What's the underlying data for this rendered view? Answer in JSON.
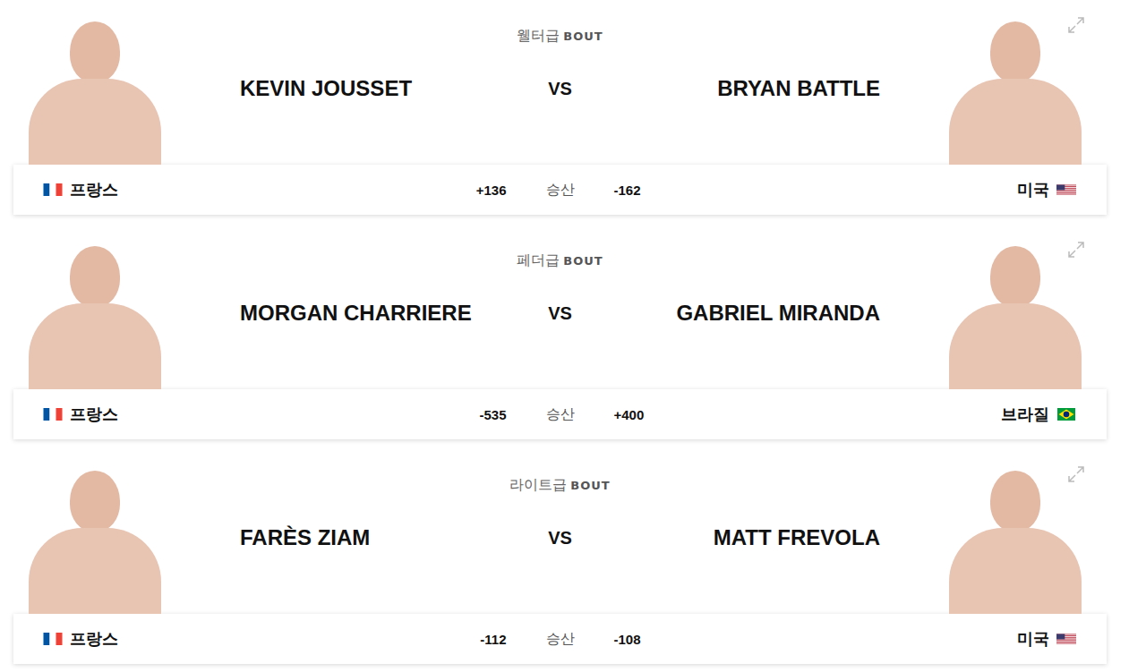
{
  "bouts": [
    {
      "weight_class": "웰터급",
      "bout_label": "BOUT",
      "vs": "VS",
      "odds_label": "승산",
      "left": {
        "name": "KEVIN JOUSSET",
        "country": "프랑스",
        "kind": "fr",
        "odds": "+136"
      },
      "right": {
        "name": "BRYAN BATTLE",
        "country": "미국",
        "kind": "us",
        "odds": "-162"
      }
    },
    {
      "weight_class": "페더급",
      "bout_label": "BOUT",
      "vs": "VS",
      "odds_label": "승산",
      "left": {
        "name": "MORGAN CHARRIERE",
        "country": "프랑스",
        "kind": "fr",
        "odds": "-535"
      },
      "right": {
        "name": "GABRIEL MIRANDA",
        "country": "브라질",
        "kind": "br",
        "odds": "+400"
      }
    },
    {
      "weight_class": "라이트급",
      "bout_label": "BOUT",
      "vs": "VS",
      "odds_label": "승산",
      "left": {
        "name": "FARÈS ZIAM",
        "country": "프랑스",
        "kind": "fr",
        "odds": "-112"
      },
      "right": {
        "name": "MATT FREVOLA",
        "country": "미국",
        "kind": "us",
        "odds": "-108"
      }
    }
  ]
}
